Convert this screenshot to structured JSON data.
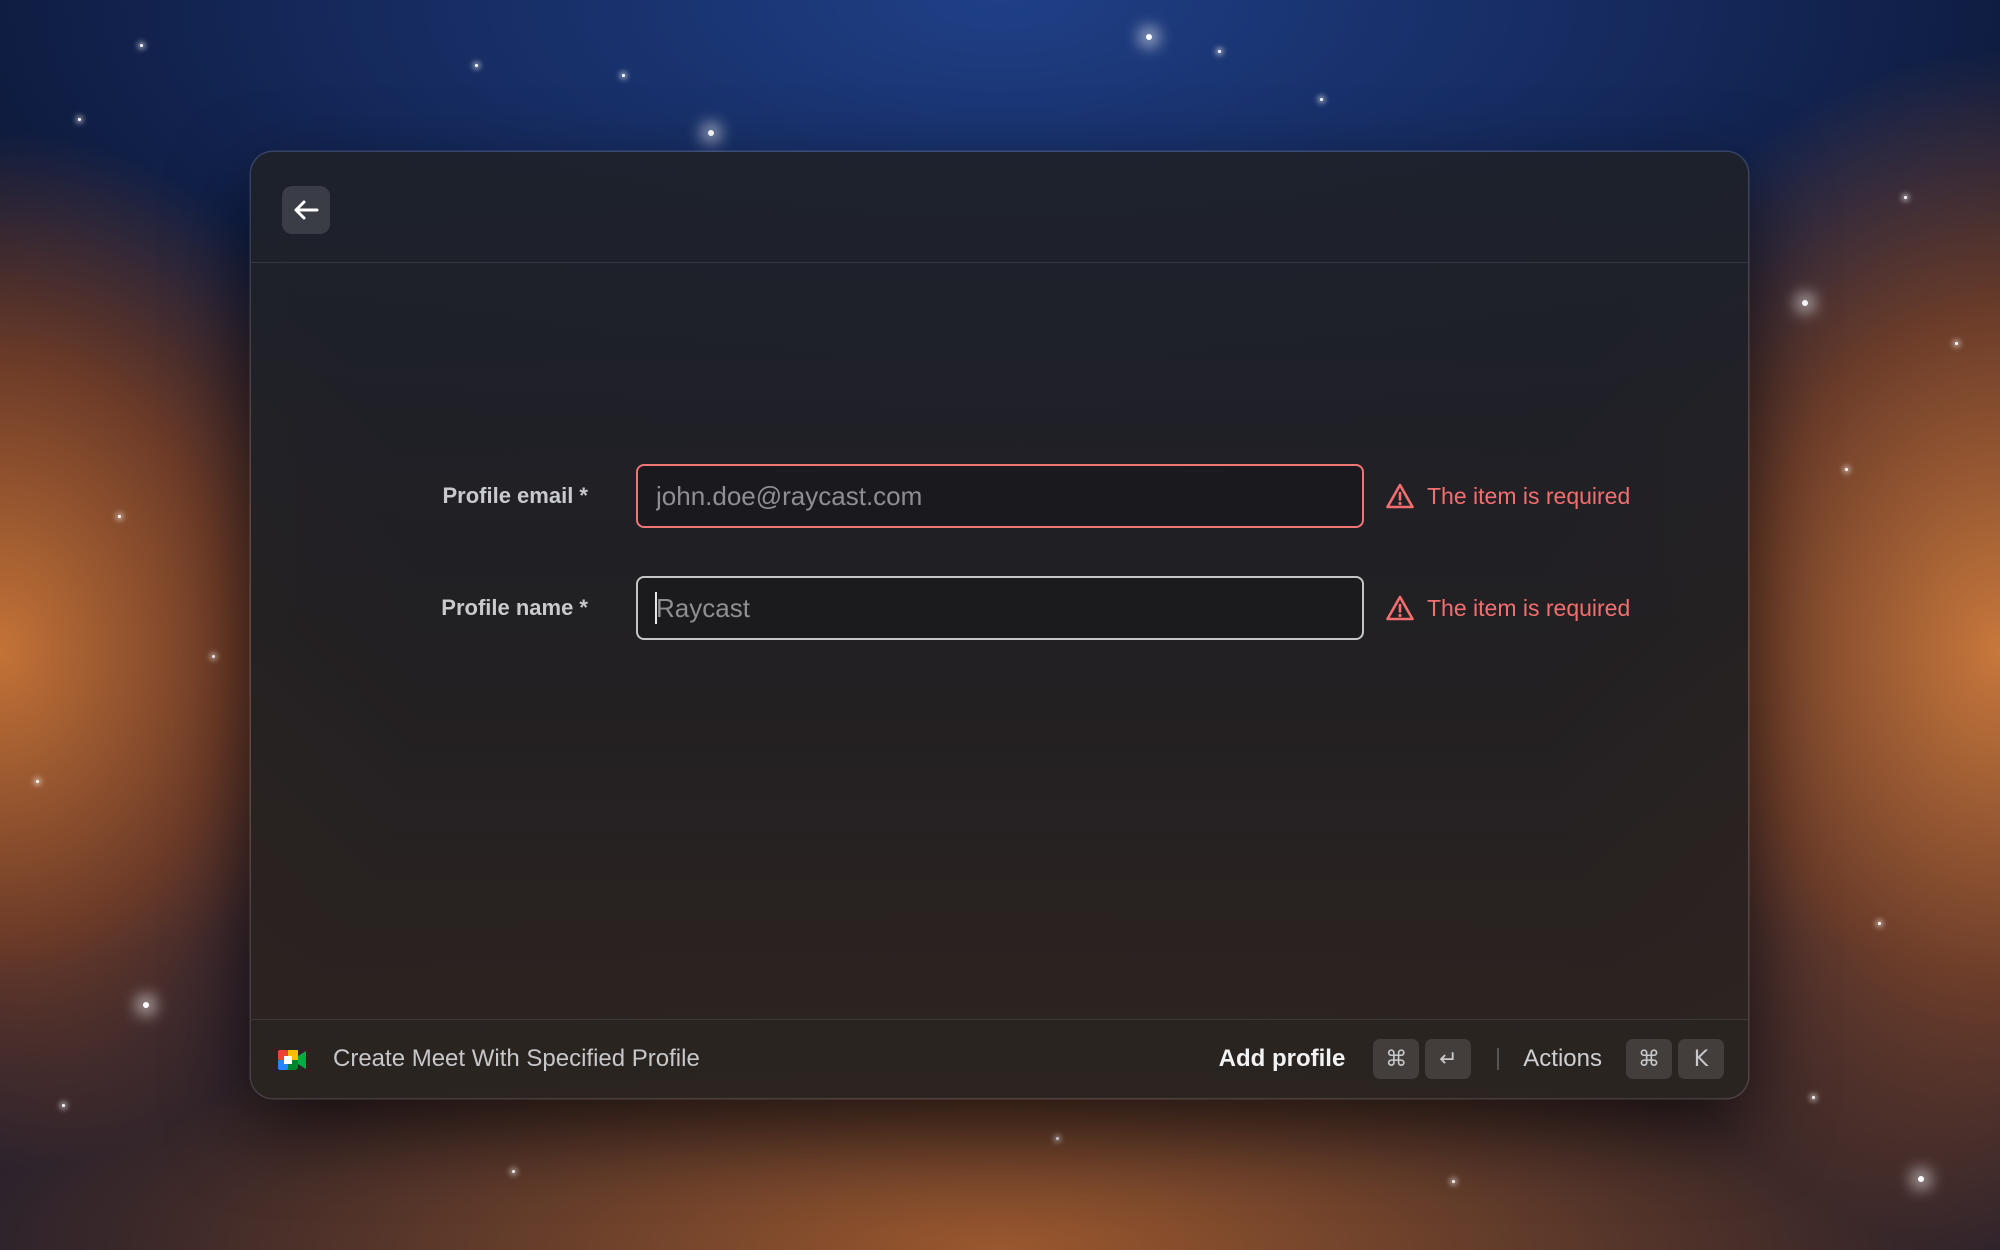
{
  "colors": {
    "error": "#f36f6f",
    "window_background": "#1d212b"
  },
  "header": {
    "back_icon": "arrow-left-icon"
  },
  "form": {
    "fields": [
      {
        "label": "Profile email *",
        "value": "",
        "placeholder": "john.doe@raycast.com",
        "error": "The item is required",
        "error_icon": "warning-triangle-icon"
      },
      {
        "label": "Profile name *",
        "value": "",
        "placeholder": "Raycast",
        "error": "The item is required",
        "error_icon": "warning-triangle-icon"
      }
    ]
  },
  "footer": {
    "app_icon": "google-meet-icon",
    "title": "Create Meet With Specified Profile",
    "primary_action": {
      "label": "Add profile",
      "shortcut": [
        "⌘",
        "↵"
      ]
    },
    "secondary_action": {
      "label": "Actions",
      "shortcut": [
        "⌘",
        "K"
      ]
    }
  }
}
